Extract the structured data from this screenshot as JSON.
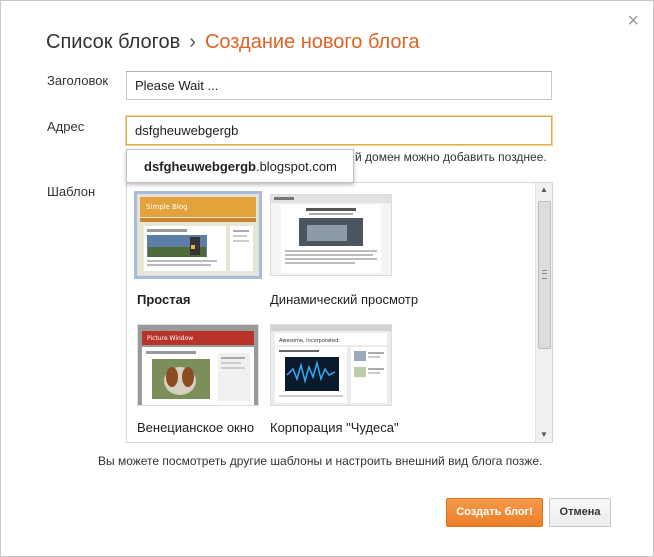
{
  "header": {
    "breadcrumb_parent": "Список блогов",
    "separator": "›",
    "breadcrumb_current": "Создание нового блога"
  },
  "close_glyph": "×",
  "form": {
    "title_label": "Заголовок",
    "title_value": "Please Wait ...",
    "address_label": "Адрес",
    "address_value": "dsfgheuwebgergb",
    "address_hint": "й домен можно добавить позднее.",
    "autocomplete_bold": "dsfgheuwebgergb",
    "autocomplete_suffix": ".blogspot.com",
    "template_label": "Шаблон"
  },
  "templates": [
    {
      "name": "Простая",
      "selected": true,
      "thumb_title": "Simple Blog"
    },
    {
      "name": "Динамический просмотр",
      "selected": false,
      "thumb_title": ""
    },
    {
      "name": "Венецианское окно",
      "selected": false,
      "thumb_title": "Picture Window"
    },
    {
      "name": "Корпорация \"Чудеса\"",
      "selected": false,
      "thumb_title": "Awesome, Incorporated"
    }
  ],
  "footer_note": "Вы можете посмотреть другие шаблоны и настроить внешний вид блога позже.",
  "buttons": {
    "create": "Создать блог!",
    "cancel": "Отмена"
  },
  "colors": {
    "accent": "#dd6325",
    "primary_button": "#f08a37",
    "focus_border": "#e3a94a",
    "selected_template": "#a9bdd8"
  }
}
